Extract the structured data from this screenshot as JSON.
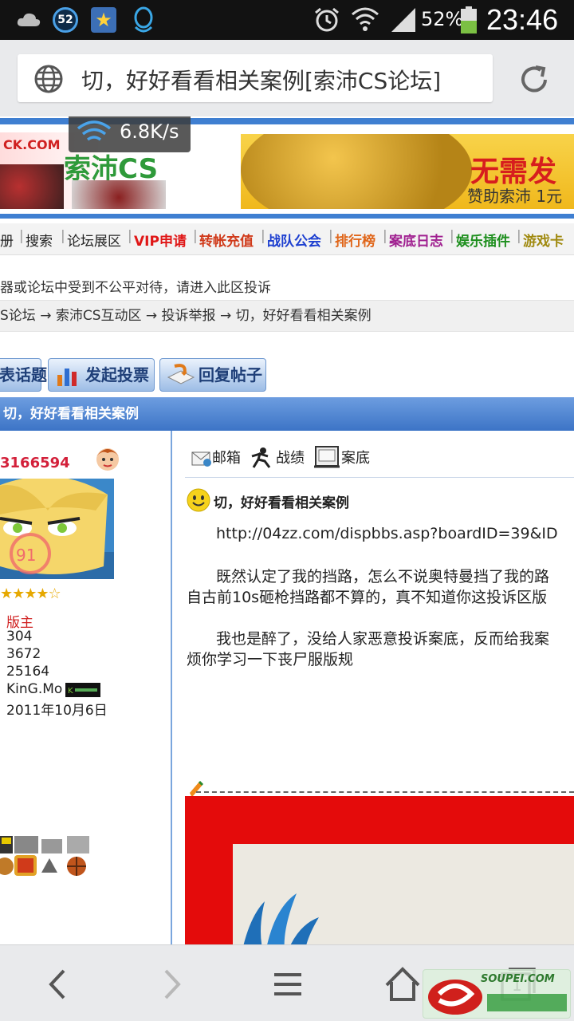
{
  "status_bar": {
    "badge_count": "52",
    "battery": "52%",
    "time": "23:46",
    "icons": [
      "cloud-icon",
      "badge-52-icon",
      "star-app-icon",
      "qq-icon",
      "alarm-icon",
      "wifi-icon",
      "signal-icon",
      "battery-icon"
    ]
  },
  "browser": {
    "tab_title": "切，好好看看相关案例[索沛CS论坛]",
    "speed": "6.8K/s"
  },
  "banner": {
    "left_text_top": "CK.COM",
    "left_text_main": "索沛CS",
    "ad_main": "无需发",
    "ad_sub": "赞助索沛 1元"
  },
  "nav": [
    "册",
    "搜索",
    "论坛展区",
    "VIP申请",
    "转帐充值",
    "战队公会",
    "排行榜",
    "案底日志",
    "娱乐插件",
    "游戏卡"
  ],
  "nav_colors": [
    "#222222",
    "#222222",
    "#222222",
    "#e01717",
    "#d03a1a",
    "#1d3fd0",
    "#e0661a",
    "#a02090",
    "#1e8f1e",
    "#a08a10"
  ],
  "notice": "器或论坛中受到不公平对待，请进入此区投诉",
  "breadcrumb": "S论坛 → 索沛CS互动区 → 投诉举报 → 切，好好看看相关案例",
  "buttons": {
    "new_topic": "表话题",
    "new_vote": "发起投票",
    "reply": "回复帖子"
  },
  "thread_title": "切，好好看看相关案例",
  "user": {
    "uid": "3166594",
    "stars": "★★★★☆",
    "avatar_number": "91",
    "rank": "版主",
    "posts": "304",
    "points": "3672",
    "money": "25164",
    "clan": "KinG.Mo",
    "joined": "2011年10月6日"
  },
  "post_tools": {
    "mail": "邮箱",
    "stats": "战绩",
    "record": "案底"
  },
  "post": {
    "title": "切，好好看看相关案例",
    "line1": "http://04zz.com/dispbbs.asp?boardID=39&ID",
    "line2": "既然认定了我的挡路，怎么不说奥特曼挡了我的路",
    "line3": "自古前10s砸枪挡路都不算的，真不知道你这投诉区版",
    "line4": "我也是醉了，没给人家恶意投诉案底，反而给我案",
    "line5": "烦你学习一下丧尸服版规"
  },
  "bottom_bar": {
    "tab_count": "1",
    "watermark": "SOUPEI.COM"
  }
}
